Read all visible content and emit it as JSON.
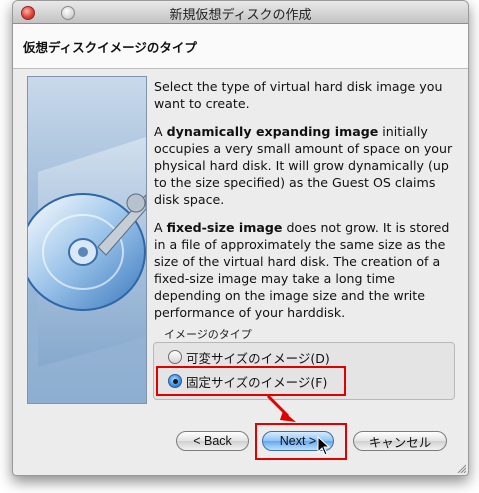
{
  "window": {
    "title": "新規仮想ディスクの作成"
  },
  "header": {
    "title": "仮想ディスクイメージのタイプ"
  },
  "body": {
    "paragraph1": "Select the type of virtual hard disk image you want to create.",
    "paragraph2_bold": "dynamically expanding image",
    "paragraph2_prefix": "A ",
    "paragraph2_rest": " initially occupies a very small amount of space on your physical hard disk. It will grow dynamically (up to the size specified) as the Guest OS claims disk space.",
    "paragraph3_prefix": "A ",
    "paragraph3_bold": "fixed-size image",
    "paragraph3_rest": " does not grow. It is stored in a file of approximately the same size as the size of the virtual hard disk. The creation of a fixed-size image may take a long time depending on the image size and the write performance of your harddisk."
  },
  "image_type_group": {
    "label": "イメージのタイプ",
    "options": [
      {
        "label": "可変サイズのイメージ(D)",
        "selected": false
      },
      {
        "label": "固定サイズのイメージ(F)",
        "selected": true
      }
    ]
  },
  "buttons": {
    "back": "< Back",
    "next": "Next >",
    "cancel": "キャンセル"
  },
  "colors": {
    "annotation": "#e10000",
    "default_button": "#62a8ee"
  }
}
